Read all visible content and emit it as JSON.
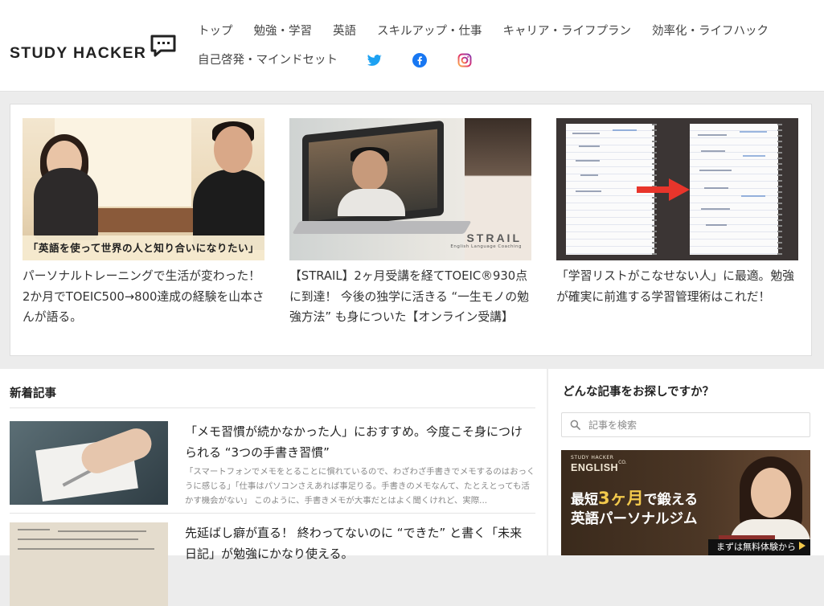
{
  "header": {
    "logo_text": "STUDY HACKER",
    "nav": [
      {
        "label": "トップ"
      },
      {
        "label": "勉強・学習"
      },
      {
        "label": "英語"
      },
      {
        "label": "スキルアップ・仕事"
      },
      {
        "label": "キャリア・ライフプラン"
      },
      {
        "label": "効率化・ライフハック"
      },
      {
        "label": "自己啓発・マインドセット"
      }
    ],
    "social": {
      "twitter_color": "#1DA1F2",
      "facebook_color": "#1877F2",
      "instagram_color": "#E1306C"
    }
  },
  "featured": [
    {
      "image_caption": "「英語を使って世界の人と知り合いになりたい」",
      "title": "パーソナルトレーニングで生活が変わった！　2か月でTOEIC500→800達成の経験を山本さんが語る。"
    },
    {
      "image_brand": "STRAIL",
      "image_brand_sub": "English Language Coaching",
      "title": "【STRAIL】2ヶ月受講を経てTOEIC®930点に到達！ 今後の独学に活きる “一生モノの勉強方法” も身についた【オンライン受講】"
    },
    {
      "title": "「学習リストがこなせない人」に最適。勉強が確実に前進する学習管理術はこれだ！"
    }
  ],
  "main": {
    "section_title": "新着記事",
    "articles": [
      {
        "title": "「メモ習慣が続かなかった人」におすすめ。今度こそ身につけられる “3つの手書き習慣”",
        "excerpt": "「スマートフォンでメモをとることに慣れているので、わざわざ手書きでメモするのはおっくうに感じる」「仕事はパソコンさえあれば事足りる。手書きのメモなんて、たとえとっても活かす機会がない」 このように、手書きメモが大事だとはよく聞くけれど、実際..."
      },
      {
        "title": "先延ばし癖が直る！ 終わってないのに “できた” と書く「未来日記」が勉強にかなり使える。"
      }
    ]
  },
  "sidebar": {
    "title": "どんな記事をお探しですか？",
    "search_placeholder": "記事を検索",
    "banner": {
      "brand_small": "STUDY HACKER",
      "brand_big": "ENGLISH",
      "brand_sup": "CO.",
      "line1_pre": "最短",
      "line1_em": "3ヶ月",
      "line1_post": "で鍛える",
      "line2": "英語パーソナルジム",
      "cta": "まずは無料体験から"
    }
  },
  "colors": {
    "accent_arrow": "#e8352b",
    "banner_yellow": "#f2c94c"
  }
}
